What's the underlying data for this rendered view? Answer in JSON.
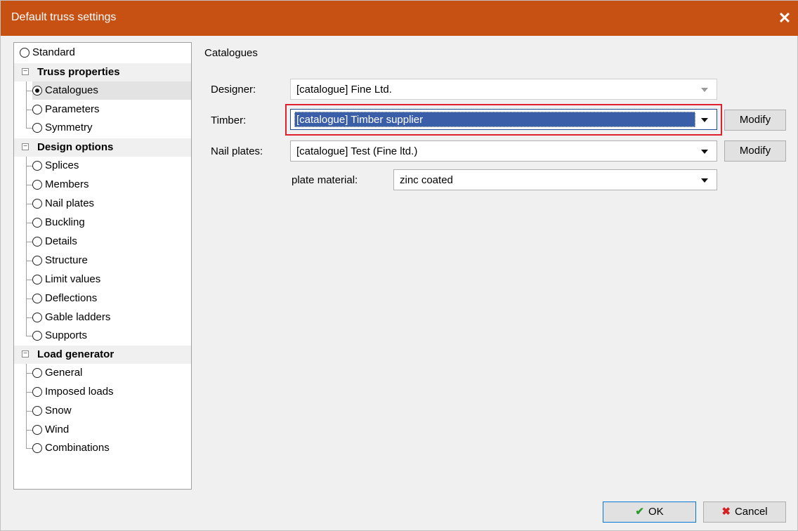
{
  "window": {
    "title": "Default truss settings",
    "close_glyph": "✕"
  },
  "tree": {
    "standard": "Standard",
    "groups": [
      {
        "label": "Truss properties",
        "items": [
          "Catalogues",
          "Parameters",
          "Symmetry"
        ]
      },
      {
        "label": "Design options",
        "items": [
          "Splices",
          "Members",
          "Nail plates",
          "Buckling",
          "Details",
          "Structure",
          "Limit values",
          "Deflections",
          "Gable ladders",
          "Supports"
        ]
      },
      {
        "label": "Load generator",
        "items": [
          "General",
          "Imposed loads",
          "Snow",
          "Wind",
          "Combinations"
        ]
      }
    ],
    "selected": "Catalogues"
  },
  "panel": {
    "title": "Catalogues",
    "designer": {
      "label": "Designer:",
      "value": "[catalogue] Fine Ltd."
    },
    "timber": {
      "label": "Timber:",
      "value": "[catalogue] Timber supplier",
      "button": "Modify"
    },
    "nail_plates": {
      "label": "Nail plates:",
      "value": "[catalogue] Test (Fine ltd.)",
      "button": "Modify"
    },
    "plate_material": {
      "label": "plate material:",
      "value": "zinc coated"
    }
  },
  "footer": {
    "ok": "OK",
    "cancel": "Cancel"
  },
  "colors": {
    "titlebar": "#c75013",
    "highlight": "#e0202e",
    "selection": "#3b5ea8"
  }
}
